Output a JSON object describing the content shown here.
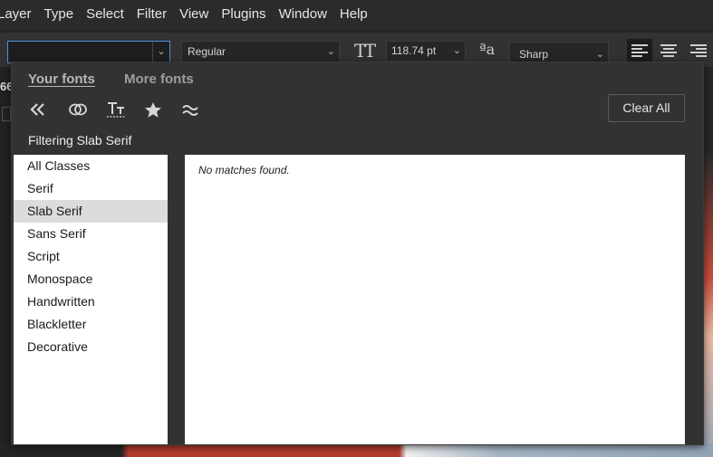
{
  "menubar": {
    "items": [
      "Layer",
      "Type",
      "Select",
      "Filter",
      "View",
      "Plugins",
      "Window",
      "Help"
    ]
  },
  "options_bar": {
    "font_family": "",
    "font_style": "Regular",
    "font_size": "118.74 pt",
    "anti_alias": "Sharp",
    "accent_color": "#4a90e2"
  },
  "background": {
    "left_label": "66"
  },
  "font_panel": {
    "tabs": [
      "Your fonts",
      "More fonts"
    ],
    "filter_icons": [
      "chevrons-left-icon",
      "creative-cloud-icon",
      "similar-fonts-icon",
      "star-icon",
      "approx-icon"
    ],
    "clear_all_label": "Clear All",
    "filter_status": "Filtering Slab Serif",
    "classes": [
      {
        "label": "All Classes",
        "selected": false
      },
      {
        "label": "Serif",
        "selected": false
      },
      {
        "label": "Slab Serif",
        "selected": true
      },
      {
        "label": "Sans Serif",
        "selected": false
      },
      {
        "label": "Script",
        "selected": false
      },
      {
        "label": "Monospace",
        "selected": false
      },
      {
        "label": "Handwritten",
        "selected": false
      },
      {
        "label": "Blackletter",
        "selected": false
      },
      {
        "label": "Decorative",
        "selected": false
      }
    ],
    "results_message": "No matches found."
  }
}
